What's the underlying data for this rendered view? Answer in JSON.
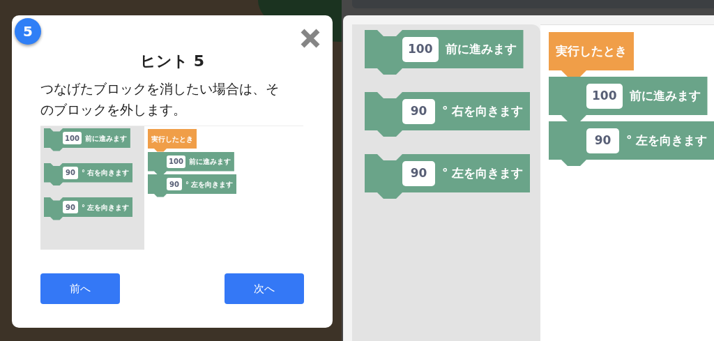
{
  "hint": {
    "number": "5",
    "title": "ヒント 5",
    "text": "つなげたブロックを消したい場合は、そのブロックを外します。",
    "preview": {
      "palette": [
        {
          "kind": "command",
          "value": "100",
          "label": "前に進みます"
        },
        {
          "kind": "command",
          "value": "90",
          "label": "° 右を向きます"
        },
        {
          "kind": "command",
          "value": "90",
          "label": "° 左を向きます"
        }
      ],
      "script": [
        {
          "kind": "hat",
          "label": "実行したとき"
        },
        {
          "kind": "command",
          "value": "100",
          "label": "前に進みます"
        },
        {
          "kind": "command",
          "value": "90",
          "label": "° 左を向きます"
        }
      ]
    },
    "buttons": [
      {
        "label": "前へ"
      },
      {
        "label": "次へ"
      }
    ]
  },
  "editor": {
    "palette": [
      {
        "kind": "command",
        "value": "100",
        "label": "前に進みます"
      },
      {
        "kind": "command",
        "value": "90",
        "label": "° 右を向きます"
      },
      {
        "kind": "command",
        "value": "90",
        "label": "° 左を向きます"
      }
    ],
    "script": [
      {
        "kind": "hat",
        "label": "実行したとき"
      },
      {
        "kind": "command",
        "value": "100",
        "label": "前に進みます"
      },
      {
        "kind": "command",
        "value": "90",
        "label": "° 左を向きます"
      }
    ]
  }
}
